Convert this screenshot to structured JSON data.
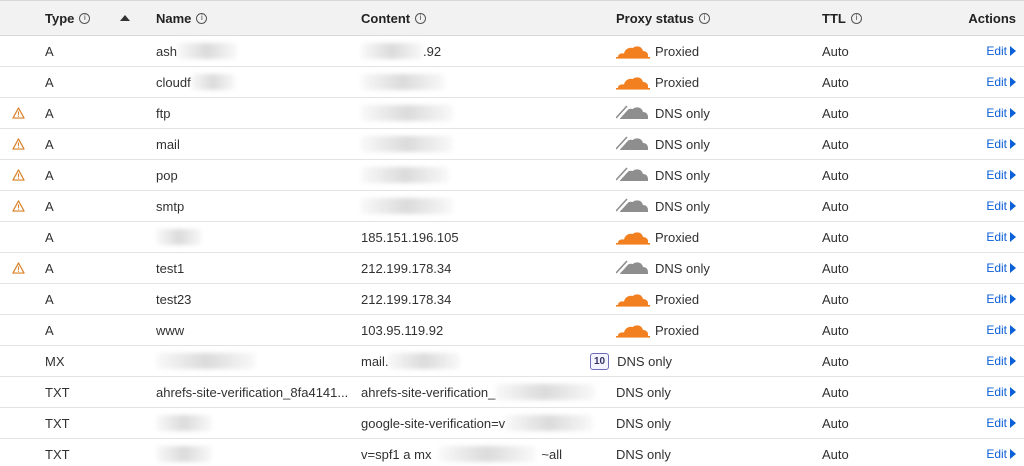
{
  "header": {
    "type": "Type",
    "name": "Name",
    "content": "Content",
    "proxy_status": "Proxy status",
    "ttl": "TTL",
    "actions": "Actions"
  },
  "colors": {
    "proxied_cloud": "#f38020",
    "dns_only_cloud": "#8e8e8e",
    "edit_link": "#0b5fd7"
  },
  "rows": [
    {
      "warning": false,
      "type": "A",
      "name": "ash",
      "name_blur": 60,
      "content": ".92",
      "content_prefix_blur": 62,
      "proxy": "Proxied",
      "proxied": true,
      "ttl": "Auto",
      "edit": "Edit"
    },
    {
      "warning": false,
      "type": "A",
      "name": "cloudf",
      "name_blur": 44,
      "content": "",
      "content_blur": 84,
      "proxy": "Proxied",
      "proxied": true,
      "ttl": "Auto",
      "edit": "Edit"
    },
    {
      "warning": true,
      "type": "A",
      "name": "ftp",
      "content": "",
      "content_blur": 92,
      "proxy": "DNS only",
      "proxied": false,
      "ttl": "Auto",
      "edit": "Edit"
    },
    {
      "warning": true,
      "type": "A",
      "name": "mail",
      "content": "",
      "content_blur": 92,
      "proxy": "DNS only",
      "proxied": false,
      "ttl": "Auto",
      "edit": "Edit"
    },
    {
      "warning": true,
      "type": "A",
      "name": "pop",
      "content": "",
      "content_blur": 88,
      "proxy": "DNS only",
      "proxied": false,
      "ttl": "Auto",
      "edit": "Edit"
    },
    {
      "warning": true,
      "type": "A",
      "name": "smtp",
      "content": "",
      "content_blur": 92,
      "proxy": "DNS only",
      "proxied": false,
      "ttl": "Auto",
      "edit": "Edit"
    },
    {
      "warning": false,
      "type": "A",
      "name": "",
      "name_blur": 46,
      "content": "185.151.196.105",
      "proxy": "Proxied",
      "proxied": true,
      "ttl": "Auto",
      "edit": "Edit"
    },
    {
      "warning": true,
      "type": "A",
      "name": "test1",
      "content": "212.199.178.34",
      "proxy": "DNS only",
      "proxied": false,
      "ttl": "Auto",
      "edit": "Edit"
    },
    {
      "warning": false,
      "type": "A",
      "name": "test23",
      "content": "212.199.178.34",
      "proxy": "Proxied",
      "proxied": true,
      "ttl": "Auto",
      "edit": "Edit"
    },
    {
      "warning": false,
      "type": "A",
      "name": "www",
      "content": "103.95.119.92",
      "proxy": "Proxied",
      "proxied": true,
      "ttl": "Auto",
      "edit": "Edit"
    },
    {
      "warning": false,
      "type": "MX",
      "name": "",
      "name_blur": 100,
      "content": "mail.",
      "content_suffix_blur": 72,
      "priority": "10",
      "proxy": "DNS only",
      "proxied": null,
      "ttl": "Auto",
      "edit": "Edit"
    },
    {
      "warning": false,
      "type": "TXT",
      "name": "ahrefs-site-verification_8fa4141...",
      "content": "ahrefs-site-verification_",
      "content_suffix_blur": 100,
      "proxy": "DNS only",
      "proxied": null,
      "ttl": "Auto",
      "edit": "Edit"
    },
    {
      "warning": false,
      "type": "TXT",
      "name": "",
      "name_blur": 56,
      "content": "google-site-verification=v",
      "content_suffix_blur": 88,
      "proxy": "DNS only",
      "proxied": null,
      "ttl": "Auto",
      "edit": "Edit"
    },
    {
      "warning": false,
      "type": "TXT",
      "name": "",
      "name_blur": 56,
      "content": "v=spf1 a mx",
      "content_mid_blur": 96,
      "content_tail": "~all",
      "proxy": "DNS only",
      "proxied": null,
      "ttl": "Auto",
      "edit": "Edit"
    }
  ]
}
